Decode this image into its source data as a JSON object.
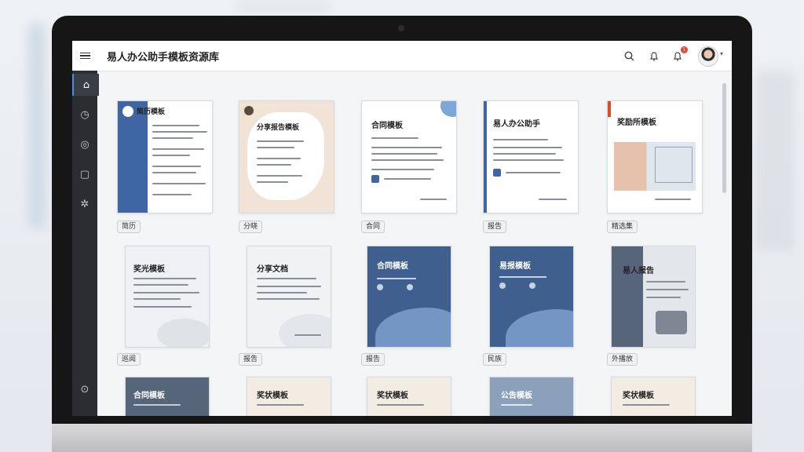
{
  "app": {
    "title": "易人办公助手模板资源库"
  },
  "topbar": {
    "search_icon": "search-icon",
    "bell_icon": "bell-icon",
    "notify_icon": "notification-icon",
    "notify_badge": "1"
  },
  "sidebar": {
    "items": [
      {
        "icon": "home-icon"
      },
      {
        "icon": "clock-icon"
      },
      {
        "icon": "palette-icon"
      },
      {
        "icon": "document-icon"
      },
      {
        "icon": "settings-icon"
      },
      {
        "icon": "help-icon"
      }
    ]
  },
  "templates": {
    "row1": [
      {
        "title": "简历模板",
        "tag": "简历"
      },
      {
        "title": "分享报告模板",
        "tag": "分晓"
      },
      {
        "title": "合同模板",
        "tag": "合同"
      },
      {
        "title": "易人办公助手",
        "tag": "报告"
      },
      {
        "title": "奖励所模板",
        "tag": "精选集"
      }
    ],
    "row2": [
      {
        "title": "奖光模板",
        "tag": "巡阅"
      },
      {
        "title": "分享文档",
        "tag": "报告"
      },
      {
        "title": "合同模板",
        "tag": "报告"
      },
      {
        "title": "易报模板",
        "tag": "民族"
      },
      {
        "title": "易人报告",
        "tag": "外播放"
      }
    ],
    "row3": [
      {
        "title": "合同模板"
      },
      {
        "title": "奖状模板"
      },
      {
        "title": "奖状模板"
      },
      {
        "title": "公告模板"
      },
      {
        "title": "奖状模板"
      }
    ]
  },
  "colors": {
    "accent": "#3f66a3",
    "sidebar": "#2b2d31",
    "badge": "#e5453b"
  }
}
